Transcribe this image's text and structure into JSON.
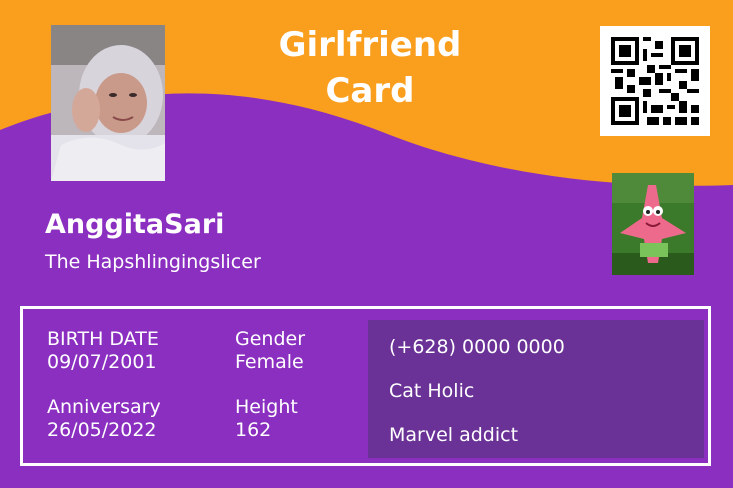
{
  "card": {
    "title_line1": "Girlfriend",
    "title_line2": "Card",
    "name": "AnggitaSari",
    "nickname": "The Hapshlingingslicer"
  },
  "fields": {
    "birth_label": "BIRTH DATE",
    "birth_value": "09/07/2001",
    "gender_label": "Gender",
    "gender_value": "Female",
    "anniversary_label": "Anniversary",
    "anniversary_value": "26/05/2022",
    "height_label": "Height",
    "height_value": "162"
  },
  "notes": [
    "(+628) 0000 0000",
    "Cat Holic",
    "Marvel addict"
  ],
  "colors": {
    "card_purple": "#8b2fc0",
    "wave_orange": "#fa9e1e",
    "notes_panel": "#6a3196",
    "text": "#ffffff"
  },
  "icons": {
    "qr": "qr-code-icon"
  }
}
